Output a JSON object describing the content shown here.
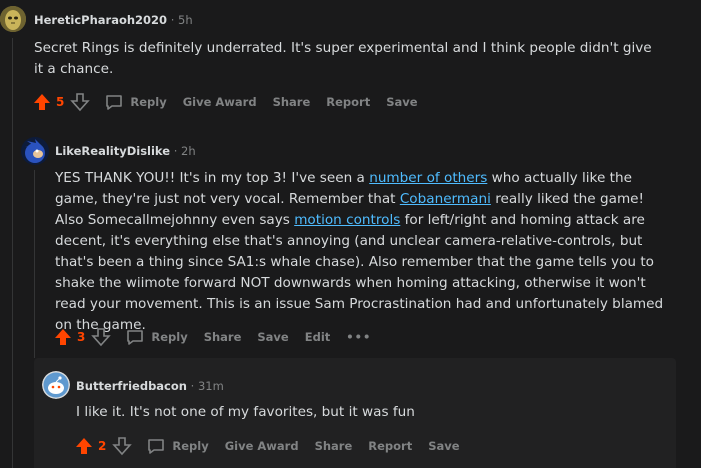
{
  "comments": [
    {
      "user": "HereticPharaoh2020",
      "time": "5h",
      "body": "Secret Rings is definitely underrated. It's super experimental and I think people didn't give it a chance.",
      "score": "5",
      "actions": [
        "Reply",
        "Give Award",
        "Share",
        "Report",
        "Save"
      ]
    },
    {
      "user": "LikeRealityDislike",
      "time": "2h",
      "body_parts": [
        "YES THANK YOU!! It's in my top 3! I've seen a ",
        "number of others",
        " who actually like the game, they're just not very vocal. Remember that ",
        "Cobanermani",
        " really liked the game! Also Somecallmejohnny even says ",
        "motion controls",
        " for left/right and homing attack are decent, it's everything else that's annoying (and unclear camera-relative-controls, but that's been a thing since SA1:s whale chase). Also remember that the game tells you to shake the wiimote forward NOT downwards when homing attacking, otherwise it won't read your movement. This is an issue Sam Procrastination had and unfortunately blamed on the game."
      ],
      "score": "3",
      "actions": [
        "Reply",
        "Share",
        "Save",
        "Edit"
      ],
      "more": "•••"
    },
    {
      "user": "Butterfriedbacon",
      "time": "31m",
      "body": "I like it. It's not one of my favorites, but it was fun",
      "score": "2",
      "actions": [
        "Reply",
        "Give Award",
        "Share",
        "Report",
        "Save"
      ]
    }
  ],
  "separator": "·",
  "colors": {
    "upvote": "#ff4500",
    "link": "#4fbcff",
    "background": "#1a1a1b"
  }
}
